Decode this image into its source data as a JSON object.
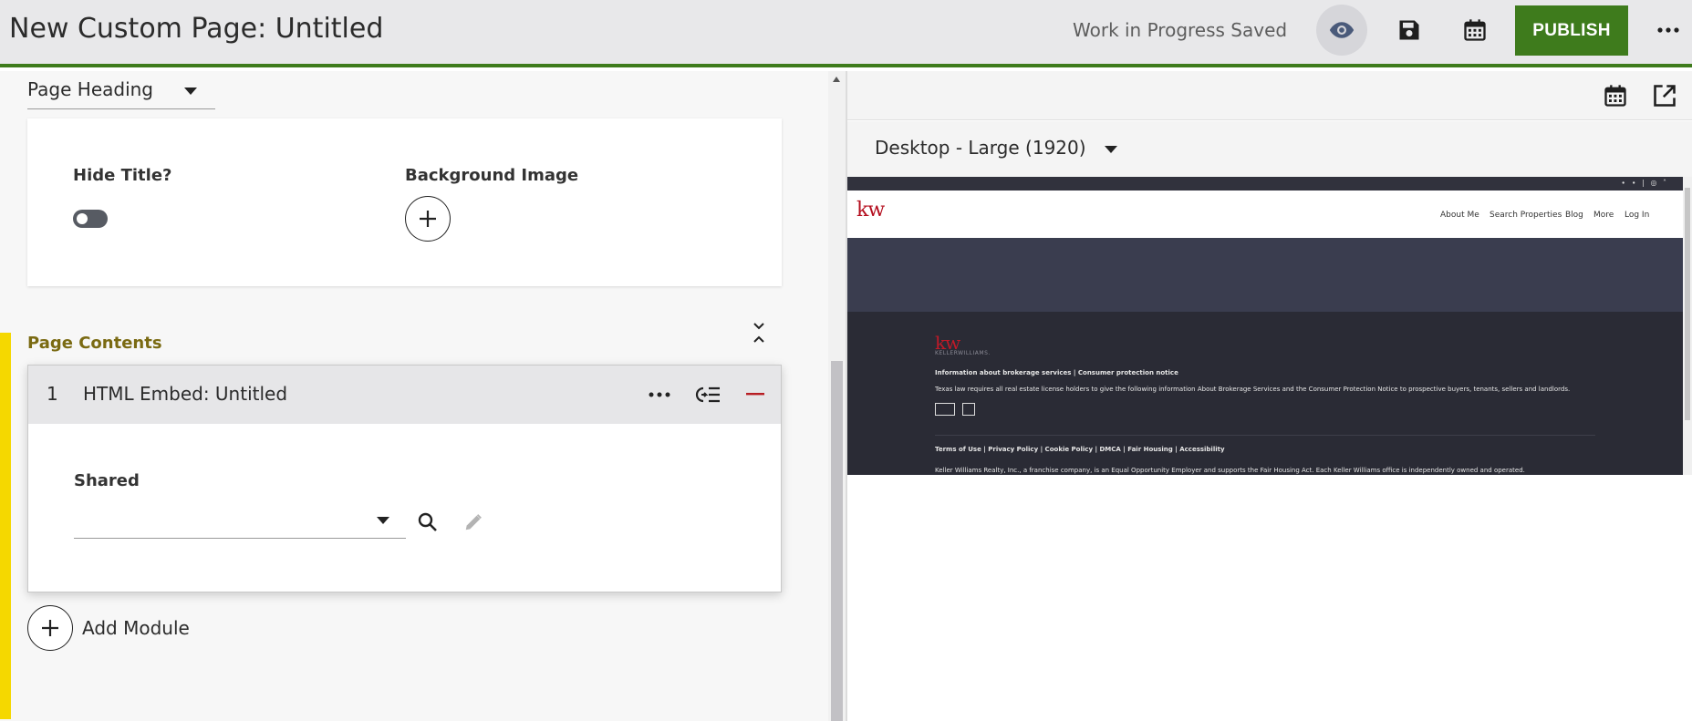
{
  "header": {
    "title": "New Custom Page: Untitled",
    "status": "Work in Progress Saved",
    "publish_label": "PUBLISH",
    "icons": [
      "eye-icon",
      "save-icon",
      "calendar-icon",
      "more-icon"
    ],
    "colors": {
      "accent": "#3e7b1c",
      "header_bg": "#e8e8ea"
    }
  },
  "editor": {
    "heading_select": {
      "value": "Page Heading"
    },
    "heading_card": {
      "hide_title_label": "Hide Title?",
      "hide_title_on": false,
      "background_image_label": "Background Image"
    },
    "contents": {
      "label": "Page Contents",
      "modules": [
        {
          "number": "1",
          "title": "HTML Embed: Untitled",
          "shared_label": "Shared",
          "shared_value": ""
        }
      ],
      "add_module_label": "Add Module"
    }
  },
  "preview": {
    "device": "Desktop - Large (1920)",
    "site": {
      "logo": "kw",
      "menu": [
        "About Me",
        "Search Properties",
        "Blog",
        "More",
        "Log In"
      ],
      "social": "∙ ∙ | ◎ ˄",
      "footer_logo": "kw",
      "footer_logo_sub": "KELLERWILLIAMS.",
      "brokerage_line": "Information about brokerage services  |  Consumer protection notice",
      "texas_notice": "Texas law requires all real estate license holders to give the following information About Brokerage Services and the Consumer Protection Notice to prospective buyers, tenants, sellers and landlords.",
      "legal_links": "Terms of Use | Privacy Policy | Cookie Policy | DMCA | Fair Housing | Accessibility",
      "copyright": "Keller Williams Realty, Inc., a franchise company, is an Equal Opportunity Employer and supports the Fair Housing Act. Each Keller Williams office is independently owned and operated."
    }
  }
}
